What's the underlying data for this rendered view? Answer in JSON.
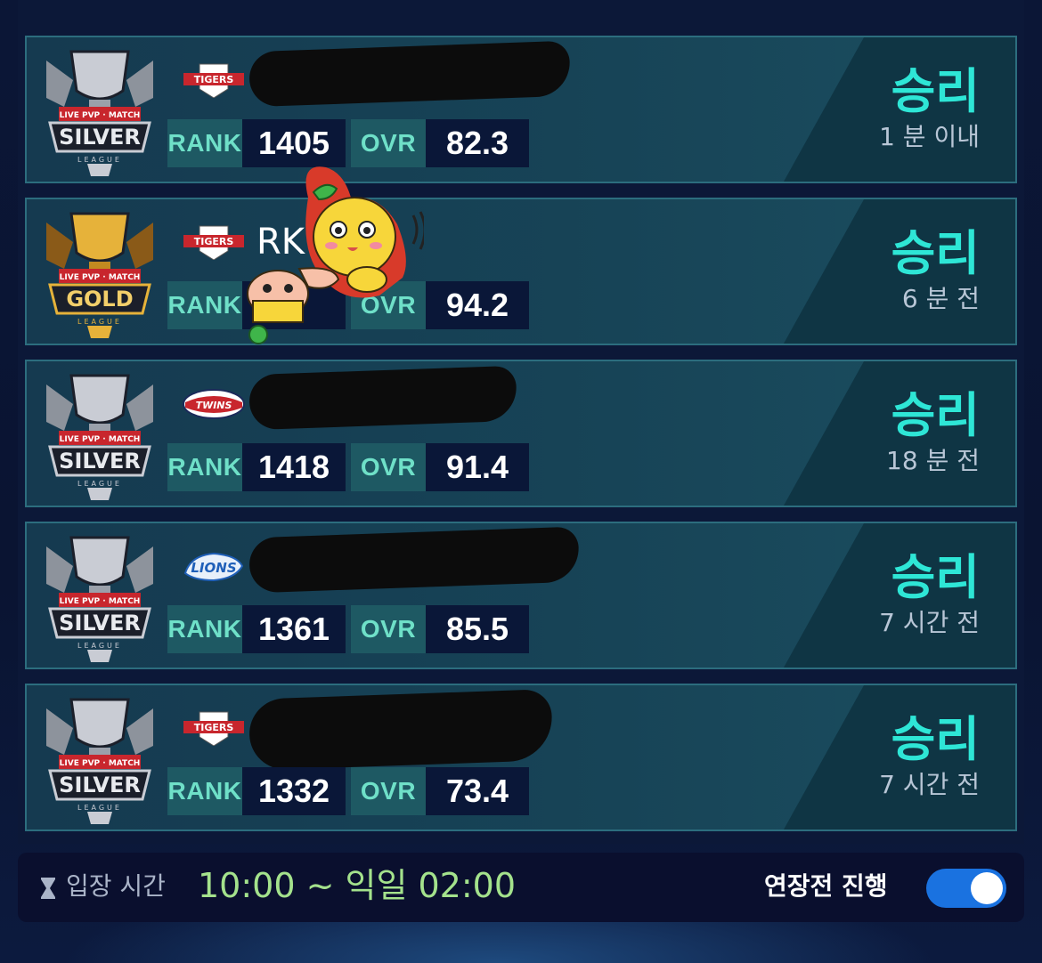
{
  "matches": [
    {
      "league": "SILVER",
      "team": "TIGERS",
      "player_name": "",
      "rank_label": "RANK",
      "rank": "1405",
      "ovr_label": "OVR",
      "ovr": "82.3",
      "result": "승리",
      "time": "1 분 이내",
      "redacted": true
    },
    {
      "league": "GOLD",
      "team": "TIGERS",
      "player_name": "RK",
      "rank_label": "RANK",
      "rank": "",
      "ovr_label": "OVR",
      "ovr": "94.2",
      "result": "승리",
      "time": "6 분 전",
      "redacted": false
    },
    {
      "league": "SILVER",
      "team": "TWINS",
      "player_name": "",
      "rank_label": "RANK",
      "rank": "1418",
      "ovr_label": "OVR",
      "ovr": "91.4",
      "result": "승리",
      "time": "18 분 전",
      "redacted": true
    },
    {
      "league": "SILVER",
      "team": "LIONS",
      "player_name": "",
      "rank_label": "RANK",
      "rank": "1361",
      "ovr_label": "OVR",
      "ovr": "85.5",
      "result": "승리",
      "time": "7 시간 전",
      "redacted": true
    },
    {
      "league": "SILVER",
      "team": "TIGERS",
      "player_name": "",
      "rank_label": "RANK",
      "rank": "1332",
      "ovr_label": "OVR",
      "ovr": "73.4",
      "result": "승리",
      "time": "7 시간 전",
      "redacted": true
    }
  ],
  "badge_text": {
    "live": "LIVE PVP · MATCH",
    "league_word": "LEAGUE"
  },
  "footer": {
    "entry_label": "입장 시간",
    "entry_time": "10:00 ~ 익일 02:00",
    "extension_label": "연장전 진행",
    "extension_on": true
  },
  "colors": {
    "win": "#2ee6d6",
    "silver": "#c9ccd4",
    "gold": "#e6b23a",
    "toggle": "#1a72e0",
    "entry_time": "#a4e28c"
  }
}
